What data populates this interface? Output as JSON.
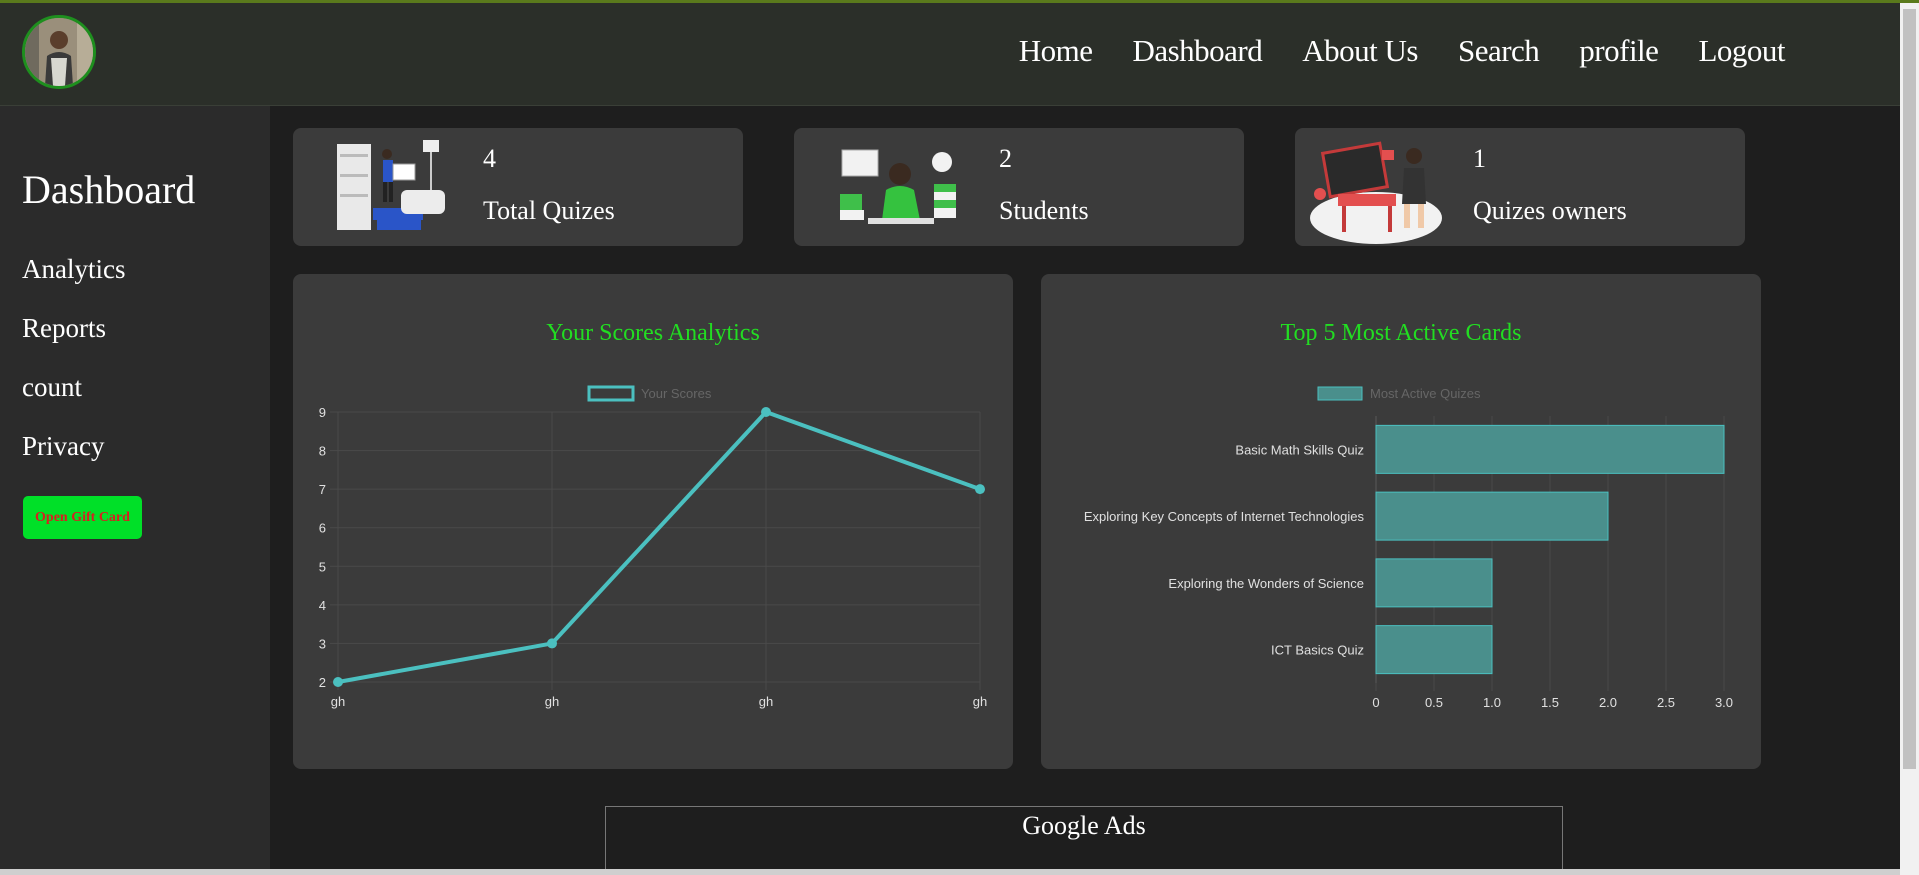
{
  "nav": {
    "items": [
      "Home",
      "Dashboard",
      "About Us",
      "Search",
      "profile",
      "Logout"
    ]
  },
  "sidebar": {
    "title": "Dashboard",
    "items": [
      "Analytics",
      "Reports",
      "count",
      "Privacy"
    ],
    "gift_button": "Open Gift Card"
  },
  "stats": [
    {
      "value": "4",
      "label": "Total Quizes"
    },
    {
      "value": "2",
      "label": "Students"
    },
    {
      "value": "1",
      "label": "Quizes owners"
    }
  ],
  "ads": {
    "label": "Google Ads"
  },
  "colors": {
    "accent": "#22dd22",
    "series": "#4bc0c0",
    "bar_fill": "#4a8f8c",
    "button": "#00e028"
  },
  "chart_data": [
    {
      "type": "line",
      "title": "Your Scores Analytics",
      "legend": "Your Scores",
      "categories": [
        "gh",
        "gh",
        "gh",
        "gh"
      ],
      "series": [
        {
          "name": "Your Scores",
          "values": [
            2,
            3,
            9,
            7
          ]
        }
      ],
      "ylim": [
        2,
        9
      ],
      "yticks": [
        "2",
        "3",
        "4",
        "5",
        "6",
        "7",
        "8",
        "9"
      ],
      "grid": true,
      "legend_position": "top"
    },
    {
      "type": "bar",
      "orientation": "horizontal",
      "title": "Top 5 Most Active Cards",
      "legend": "Most Active Quizes",
      "categories": [
        "Basic Math Skills Quiz",
        "Exploring Key Concepts of Internet Technologies",
        "Exploring the Wonders of Science",
        "ICT Basics Quiz"
      ],
      "series": [
        {
          "name": "Most Active Quizes",
          "values": [
            3,
            2,
            1,
            1
          ]
        }
      ],
      "xlim": [
        0,
        3
      ],
      "xticks": [
        "0",
        "0.5",
        "1.0",
        "1.5",
        "2.0",
        "2.5",
        "3.0"
      ],
      "grid": true,
      "legend_position": "top"
    }
  ]
}
